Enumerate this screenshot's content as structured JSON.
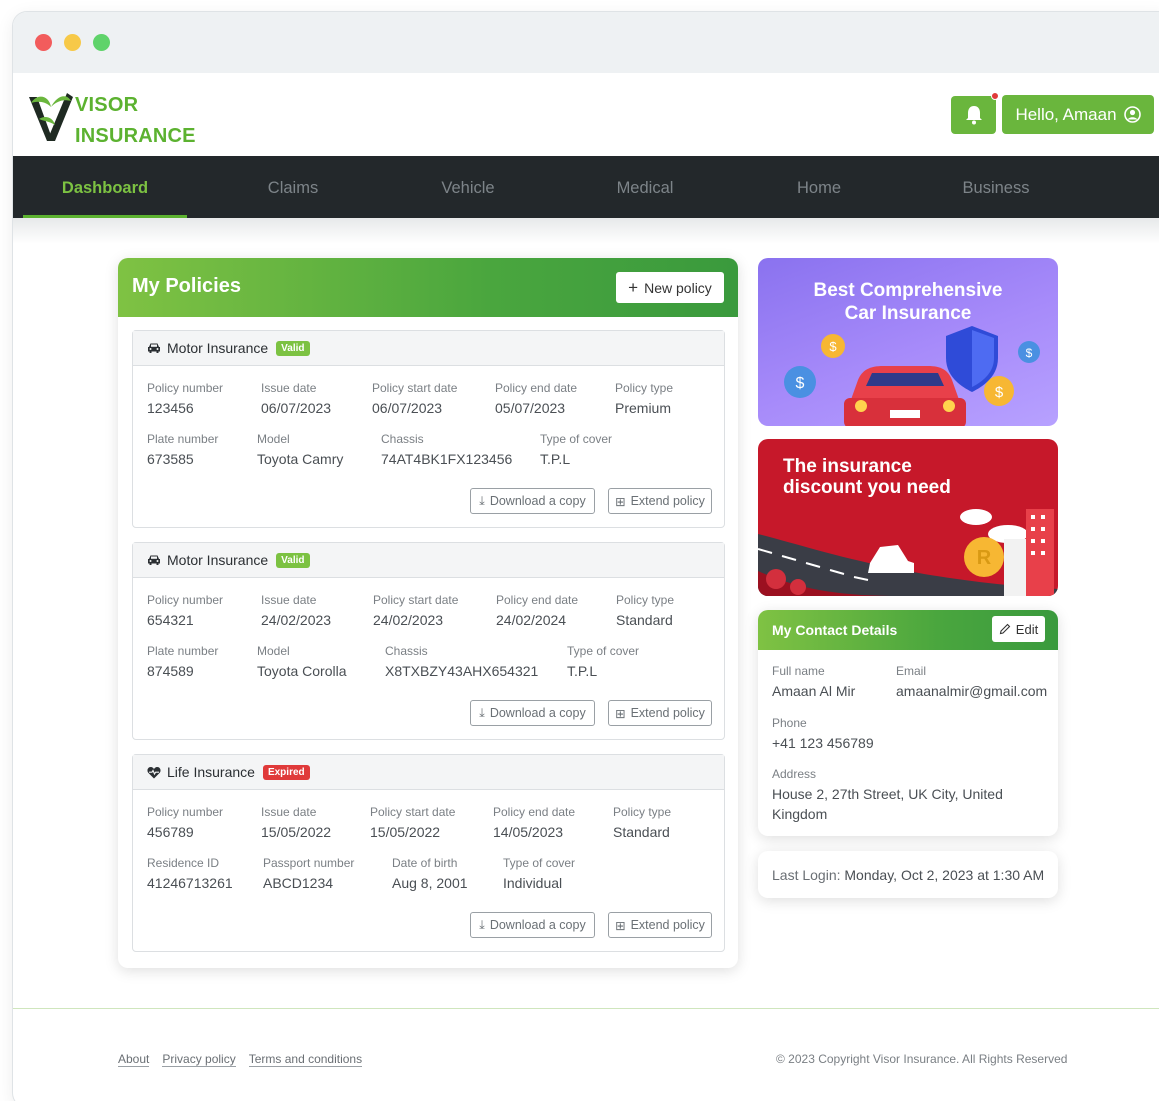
{
  "brand": {
    "line1": "VISOR",
    "line2": "INSURANCE"
  },
  "header": {
    "greeting": "Hello, Amaan"
  },
  "nav": {
    "items": [
      "Dashboard",
      "Claims",
      "Vehicle",
      "Medical",
      "Home",
      "Business"
    ],
    "active": "Dashboard"
  },
  "policies": {
    "title": "My Policies",
    "new_policy_label": "New policy",
    "download_label": "Download a copy",
    "extend_label": "Extend policy",
    "cards": [
      {
        "type": "Motor Insurance",
        "status": "Valid",
        "row1": [
          {
            "label": "Policy number",
            "value": "123456"
          },
          {
            "label": "Issue date",
            "value": "06/07/2023"
          },
          {
            "label": "Policy start date",
            "value": "06/07/2023"
          },
          {
            "label": "Policy end date",
            "value": "05/07/2023"
          },
          {
            "label": "Policy type",
            "value": "Premium"
          }
        ],
        "row2": [
          {
            "label": "Plate number",
            "value": "673585"
          },
          {
            "label": "Model",
            "value": "Toyota Camry"
          },
          {
            "label": "Chassis",
            "value": "74AT4BK1FX123456"
          },
          {
            "label": "Type of cover",
            "value": "T.P.L"
          }
        ]
      },
      {
        "type": "Motor Insurance",
        "status": "Valid",
        "row1": [
          {
            "label": "Policy number",
            "value": "654321"
          },
          {
            "label": "Issue date",
            "value": "24/02/2023"
          },
          {
            "label": "Policy start date",
            "value": "24/02/2023"
          },
          {
            "label": "Policy end date",
            "value": "24/02/2024"
          },
          {
            "label": "Policy type",
            "value": "Standard"
          }
        ],
        "row2": [
          {
            "label": "Plate number",
            "value": "874589"
          },
          {
            "label": "Model",
            "value": "Toyota Corolla"
          },
          {
            "label": "Chassis",
            "value": "X8TXBZY43AHX654321"
          },
          {
            "label": "Type of cover",
            "value": "T.P.L"
          }
        ]
      },
      {
        "type": "Life Insurance",
        "status": "Expired",
        "row1": [
          {
            "label": "Policy number",
            "value": "456789"
          },
          {
            "label": "Issue date",
            "value": "15/05/2022"
          },
          {
            "label": "Policy start date",
            "value": "15/05/2022"
          },
          {
            "label": "Policy end date",
            "value": "14/05/2023"
          },
          {
            "label": "Policy type",
            "value": "Standard"
          }
        ],
        "row2": [
          {
            "label": "Residence ID",
            "value": "41246713261"
          },
          {
            "label": "Passport number",
            "value": "ABCD1234"
          },
          {
            "label": "Date of birth",
            "value": "Aug 8, 2001"
          },
          {
            "label": "Type of cover",
            "value": "Individual"
          }
        ]
      }
    ]
  },
  "banners": {
    "car": {
      "line1": "Best Comprehensive",
      "line2": "Car Insurance"
    },
    "discount": {
      "line1": "The insurance",
      "line2": "discount you need"
    }
  },
  "contact": {
    "title": "My Contact Details",
    "edit_label": "Edit",
    "full_name_label": "Full name",
    "full_name": "Amaan Al Mir",
    "email_label": "Email",
    "email": "amaanalmir@gmail.com",
    "phone_label": "Phone",
    "phone": "+41 123 456789",
    "address_label": "Address",
    "address_line1": "House 2, 27th Street, UK City, United",
    "address_line2": "Kingdom"
  },
  "last_login": {
    "label": "Last Login:",
    "value": "Monday, Oct 2, 2023 at 1:30 AM"
  },
  "footer": {
    "links": [
      "About",
      "Privacy policy",
      "Terms and conditions"
    ],
    "copyright": "© 2023 Copyright Visor Insurance. All Rights Reserved"
  },
  "colors": {
    "brand_green": "#6ab63d",
    "nav_dark": "#23282b",
    "valid": "#7cc242",
    "expired": "#e03a3a"
  }
}
